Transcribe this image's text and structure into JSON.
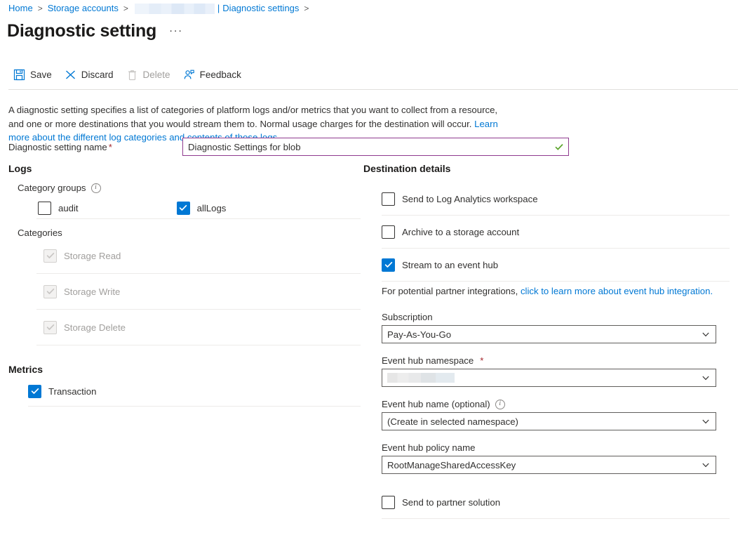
{
  "breadcrumb": {
    "items": [
      {
        "label": "Home",
        "type": "link"
      },
      {
        "label": "Storage accounts",
        "type": "link"
      },
      {
        "label": "",
        "type": "redacted"
      },
      {
        "label": "Diagnostic settings",
        "type": "link"
      }
    ],
    "separator": ">",
    "pipe": "|"
  },
  "header": {
    "title": "Diagnostic setting",
    "ellipsis": "···"
  },
  "toolbar": {
    "save_label": "Save",
    "discard_label": "Discard",
    "delete_label": "Delete",
    "feedback_label": "Feedback"
  },
  "intro": {
    "text_part1": "A diagnostic setting specifies a list of categories of platform logs and/or metrics that you want to collect from a resource, and one or more destinations that you would stream them to. Normal usage charges for the destination will occur. ",
    "link_text": "Learn more about the different log categories and contents of those logs"
  },
  "name_field": {
    "label": "Diagnostic setting name",
    "required_marker": "*",
    "value": "Diagnostic Settings for blob",
    "placeholder": "Diagnostic setting name",
    "valid": true
  },
  "logs": {
    "heading": "Logs",
    "category_groups_label": "Category groups",
    "category_groups": [
      {
        "label": "audit",
        "checked": false,
        "disabled": false
      },
      {
        "label": "allLogs",
        "checked": true,
        "disabled": false
      }
    ],
    "categories_label": "Categories",
    "categories": [
      {
        "label": "Storage Read",
        "checked": true,
        "disabled": true
      },
      {
        "label": "Storage Write",
        "checked": true,
        "disabled": true
      },
      {
        "label": "Storage Delete",
        "checked": true,
        "disabled": true
      }
    ]
  },
  "metrics": {
    "heading": "Metrics",
    "items": [
      {
        "label": "Transaction",
        "checked": true,
        "disabled": false
      }
    ]
  },
  "destination": {
    "heading": "Destination details",
    "log_analytics": {
      "label": "Send to Log Analytics workspace",
      "checked": false
    },
    "archive_storage": {
      "label": "Archive to a storage account",
      "checked": false
    },
    "event_hub": {
      "label": "Stream to an event hub",
      "checked": true
    },
    "partner_solution": {
      "label": "Send to partner solution",
      "checked": false
    },
    "hint_prefix": "For potential partner integrations, ",
    "hint_link": "click to learn more about event hub integration.",
    "subscription": {
      "label": "Subscription",
      "value": "Pay-As-You-Go"
    },
    "namespace": {
      "label": "Event hub namespace",
      "required_marker": "*",
      "value": ""
    },
    "hub_name": {
      "label": "Event hub name (optional)",
      "value": "(Create in selected namespace)"
    },
    "policy_name": {
      "label": "Event hub policy name",
      "value": "RootManageSharedAccessKey"
    }
  },
  "colors": {
    "accent": "#0078d4",
    "link": "#0078d4",
    "required": "#a4262c",
    "focus_border": "#8f3b8f",
    "valid_check": "#5ca52c",
    "disabled_text": "#a19f9d"
  }
}
